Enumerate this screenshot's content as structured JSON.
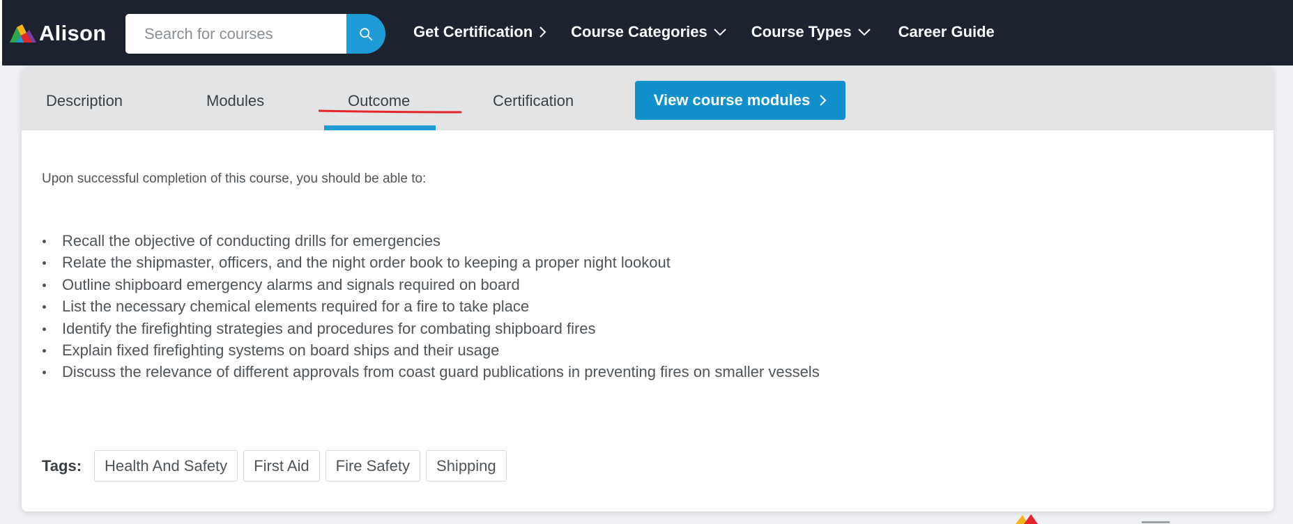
{
  "brand": {
    "name": "Alison"
  },
  "search": {
    "placeholder": "Search for courses"
  },
  "nav": {
    "links": [
      {
        "label": "Get Certification",
        "icon": "chevron-right-icon"
      },
      {
        "label": "Course Categories",
        "icon": "chevron-down-icon"
      },
      {
        "label": "Course Types",
        "icon": "chevron-down-icon"
      },
      {
        "label": "Career Guide"
      }
    ]
  },
  "tabs": {
    "items": [
      "Description",
      "Modules",
      "Outcome",
      "Certification"
    ],
    "active": "Outcome",
    "cta_label": "View course modules"
  },
  "outcome": {
    "intro": "Upon successful completion of this course, you should be able to:",
    "items": [
      "Recall the objective of conducting drills for emergencies",
      "Relate the shipmaster, officers, and the night order book to keeping a proper night lookout",
      "Outline shipboard emergency alarms and signals required on board",
      "List the necessary chemical elements required for a fire to take place",
      "Identify the firefighting strategies and procedures for combating shipboard fires",
      "Explain fixed firefighting systems on board ships and their usage",
      "Discuss the relevance of different approvals from coast guard publications in preventing fires on smaller vessels"
    ]
  },
  "tags": {
    "label": "Tags:",
    "items": [
      "Health And Safety",
      "First Aid",
      "Fire Safety",
      "Shipping"
    ]
  },
  "colors": {
    "navbar": "#1c232f",
    "accent": "#1f9bd6",
    "cta": "#1090cd",
    "annotation": "#e3262b"
  }
}
